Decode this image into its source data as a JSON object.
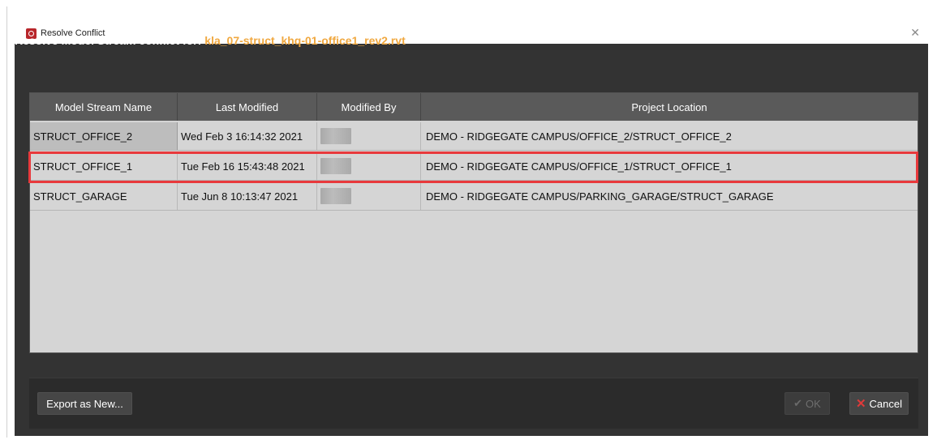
{
  "window": {
    "title": "Resolve Conflict",
    "close_glyph": "✕",
    "app_icon": "app-logo-icon"
  },
  "heading": {
    "prefix": "Resolve Model Stream conflict for:",
    "filename": "kla_07-struct_khq-01-office1_rev2.rvt"
  },
  "table": {
    "columns": [
      "Model Stream Name",
      "Last Modified",
      "Modified By",
      "Project Location"
    ],
    "rows": [
      {
        "name": "STRUCT_OFFICE_2",
        "modified": "Wed Feb 3 16:14:32 2021",
        "location": "DEMO - RIDGEGATE CAMPUS/OFFICE_2/STRUCT_OFFICE_2"
      },
      {
        "name": "STRUCT_OFFICE_1",
        "modified": "Tue Feb 16 15:43:48 2021",
        "location": "DEMO - RIDGEGATE CAMPUS/OFFICE_1/STRUCT_OFFICE_1"
      },
      {
        "name": "STRUCT_GARAGE",
        "modified": "Tue Jun 8 10:13:47 2021",
        "location": "DEMO - RIDGEGATE CAMPUS/PARKING_GARAGE/STRUCT_GARAGE"
      }
    ]
  },
  "buttons": {
    "export_label": "Export as New...",
    "ok_label": "OK",
    "ok_glyph": "✔",
    "cancel_label": "Cancel",
    "cancel_glyph": "✕"
  },
  "colors": {
    "accent_filename": "#f0a840",
    "highlight_outline": "#e8393c",
    "dialog_bg": "#333333"
  }
}
